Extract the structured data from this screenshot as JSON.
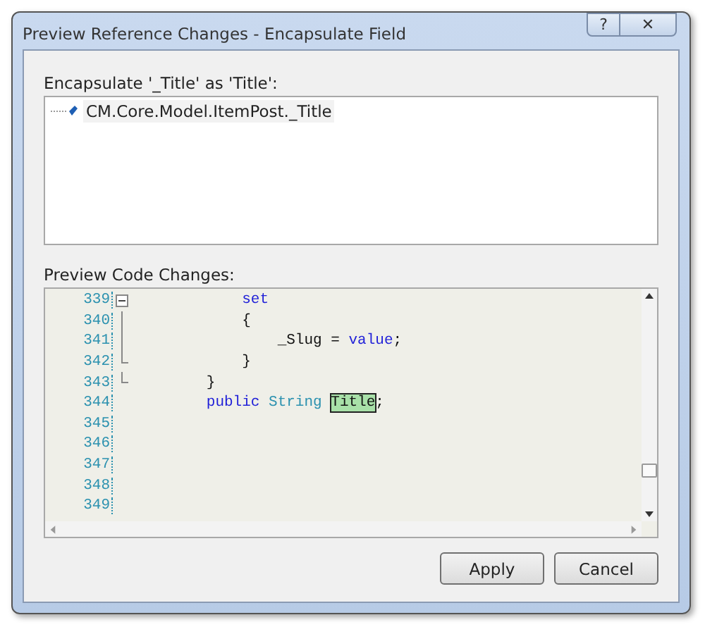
{
  "window": {
    "title": "Preview Reference Changes - Encapsulate Field",
    "buttons": [
      "?",
      "✕"
    ]
  },
  "encapsulate": {
    "label": "Encapsulate '_Title' as 'Title':",
    "items": [
      {
        "text": "CM.Core.Model.ItemPost._Title",
        "selected": false
      }
    ]
  },
  "preview": {
    "label": "Preview Code Changes:",
    "lines": [
      {
        "number": "339",
        "kind": "fold_start",
        "segments": [
          {
            "kind": "keyword",
            "text": "            set"
          }
        ]
      },
      {
        "number": "340",
        "kind": "fold_body",
        "segments": [
          {
            "kind": "plain",
            "text": "            {"
          }
        ]
      },
      {
        "number": "341",
        "kind": "fold_body",
        "segments": [
          {
            "kind": "plain",
            "text": "                _Slug = "
          },
          {
            "kind": "keyword",
            "text": "value"
          },
          {
            "kind": "plain",
            "text": ";"
          }
        ]
      },
      {
        "number": "342",
        "kind": "fold_end",
        "segments": [
          {
            "kind": "plain",
            "text": "            }"
          }
        ]
      },
      {
        "number": "343",
        "kind": "fold_end",
        "segments": [
          {
            "kind": "plain",
            "text": "        }"
          }
        ]
      },
      {
        "number": "344",
        "kind": "plain",
        "segments": [
          {
            "kind": "keyword",
            "text": "        public"
          },
          {
            "kind": "type",
            "text": " String "
          },
          {
            "kind": "highlight",
            "text": "Title"
          },
          {
            "kind": "plain",
            "text": ";"
          }
        ]
      },
      {
        "number": "345",
        "kind": "plain"
      },
      {
        "number": "346",
        "kind": "plain"
      },
      {
        "number": "347",
        "kind": "plain"
      },
      {
        "number": "348",
        "kind": "plain"
      },
      {
        "number": "349",
        "kind": "plain"
      }
    ]
  },
  "buttons": [
    "Apply",
    "Cancel"
  ]
}
